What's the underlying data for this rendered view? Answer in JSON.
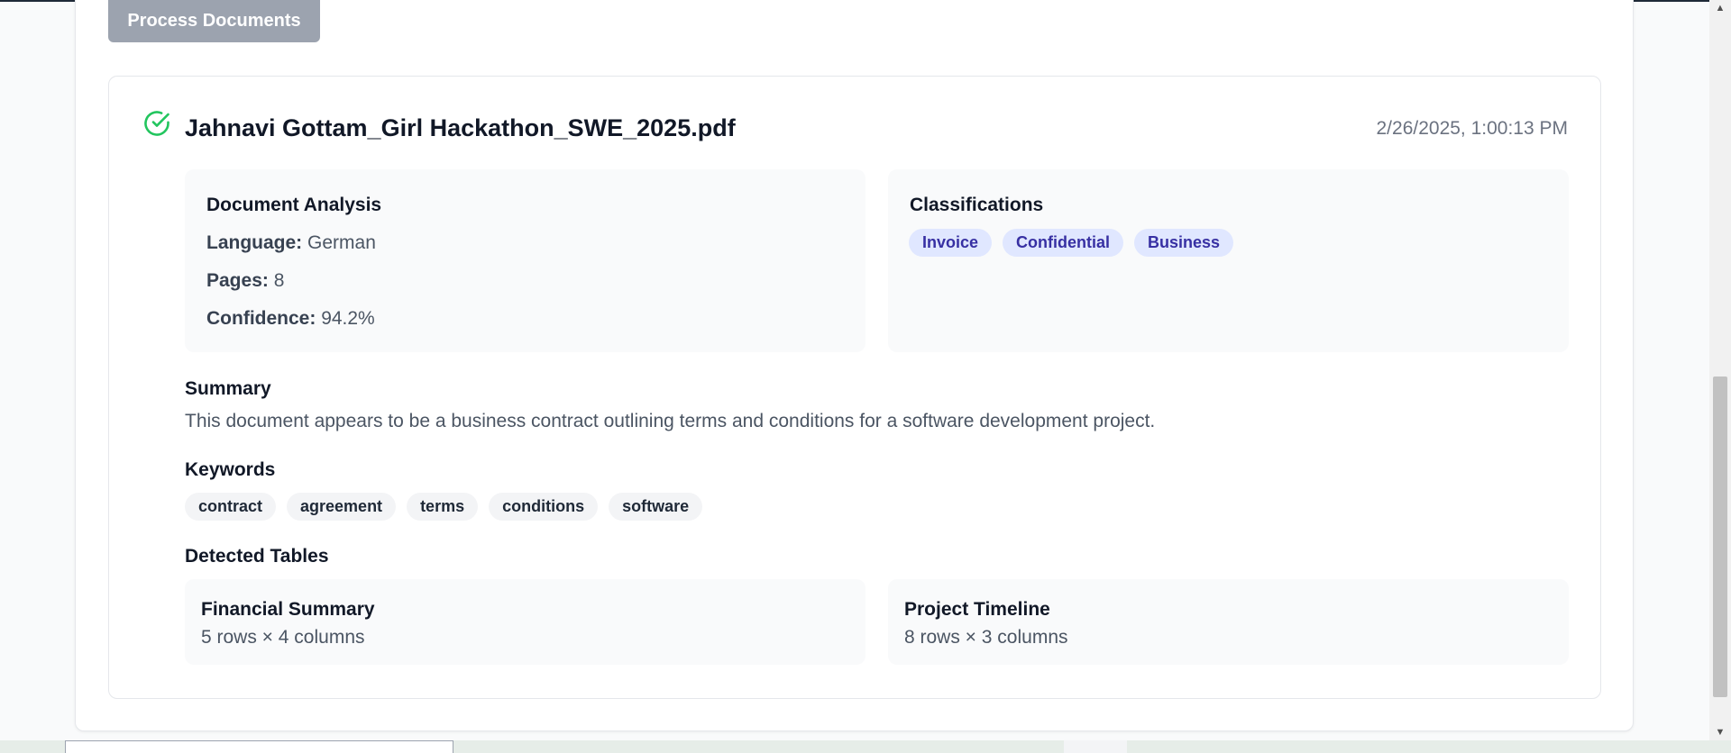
{
  "process_button_label": "Process Documents",
  "result": {
    "file_name": "Jahnavi Gottam_Girl Hackathon_SWE_2025.pdf",
    "timestamp": "2/26/2025, 1:00:13 PM",
    "status_icon": "check-circle-icon",
    "analysis": {
      "title": "Document Analysis",
      "language_label": "Language:",
      "language_value": "German",
      "pages_label": "Pages:",
      "pages_value": "8",
      "confidence_label": "Confidence:",
      "confidence_value": "94.2%"
    },
    "classifications": {
      "title": "Classifications",
      "tags": [
        "Invoice",
        "Confidential",
        "Business"
      ]
    },
    "summary": {
      "title": "Summary",
      "text": "This document appears to be a business contract outlining terms and conditions for a software development project."
    },
    "keywords": {
      "title": "Keywords",
      "items": [
        "contract",
        "agreement",
        "terms",
        "conditions",
        "software"
      ]
    },
    "tables": {
      "title": "Detected Tables",
      "items": [
        {
          "name": "Financial Summary",
          "dims": "5 rows × 4 columns"
        },
        {
          "name": "Project Timeline",
          "dims": "8 rows × 3 columns"
        }
      ]
    }
  },
  "colors": {
    "accent_success": "#22c55e",
    "button_disabled": "#9ca3af",
    "class_tag_bg": "#e0e7ff",
    "class_tag_text": "#3730a3"
  }
}
